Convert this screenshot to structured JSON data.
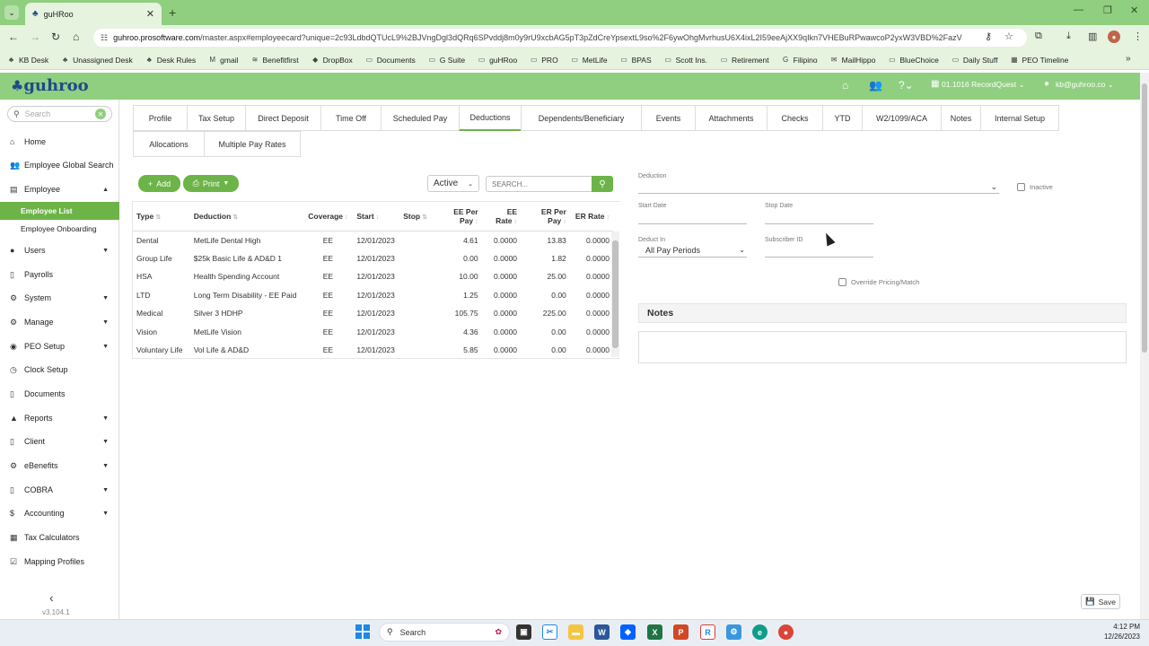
{
  "browser": {
    "tab_title": "guHRoo",
    "url_host": "guhroo.prosoftware.com",
    "url_path": "/master.aspx#employeecard?unique=2c93LdbdQTUcL9%2BJVngDgl3dQRq6SPvddj8m0y9rU9xcbAG5pT3pZdCreYpsextL9so%2F6ywOhgMvrhusU6X4ixL2I59eeAjXX9qIkn7VHEBuRPwawcoP2yxW3VBD%2FazV",
    "bookmarks": [
      {
        "label": "KB Desk",
        "icon": "kb-icon"
      },
      {
        "label": "Unassigned Desk",
        "icon": "desk-icon"
      },
      {
        "label": "Desk Rules",
        "icon": "desk-icon"
      },
      {
        "label": "gmail",
        "icon": "gmail-icon"
      },
      {
        "label": "Benefitfirst",
        "icon": "bf-icon"
      },
      {
        "label": "DropBox",
        "icon": "dropbox-icon"
      },
      {
        "label": "Documents",
        "icon": "folder-icon"
      },
      {
        "label": "G Suite",
        "icon": "folder-icon"
      },
      {
        "label": "guHRoo",
        "icon": "folder-icon"
      },
      {
        "label": "PRO",
        "icon": "folder-icon"
      },
      {
        "label": "MetLife",
        "icon": "folder-icon"
      },
      {
        "label": "BPAS",
        "icon": "folder-icon"
      },
      {
        "label": "Scott Ins.",
        "icon": "folder-icon"
      },
      {
        "label": "Retirement",
        "icon": "folder-icon"
      },
      {
        "label": "Filipino",
        "icon": "google-icon"
      },
      {
        "label": "MailHippo",
        "icon": "mailhippo-icon"
      },
      {
        "label": "BlueChoice",
        "icon": "folder-icon"
      },
      {
        "label": "Daily Stuff",
        "icon": "folder-icon"
      },
      {
        "label": "PEO Timeline",
        "icon": "sheets-icon"
      }
    ]
  },
  "header": {
    "logo": "guhroo",
    "company": "01.1016 RecordQuest",
    "user": "kb@guhroo.co"
  },
  "sidebar": {
    "search_placeholder": "Search",
    "items": [
      {
        "label": "Home",
        "icon": "home-icon",
        "top": 0
      },
      {
        "label": "Employee Global Search",
        "icon": "people-icon"
      },
      {
        "label": "Employee",
        "icon": "id-card-icon",
        "expanded": true
      },
      {
        "label": "Employee List",
        "sub": true,
        "active": true
      },
      {
        "label": "Employee Onboarding",
        "sub": true
      },
      {
        "label": "Users",
        "icon": "user-icon",
        "caret": true
      },
      {
        "label": "Payrolls",
        "icon": "doc-icon"
      },
      {
        "label": "System",
        "icon": "gear-icon",
        "caret": true
      },
      {
        "label": "Manage",
        "icon": "gears-icon",
        "caret": true
      },
      {
        "label": "PEO Setup",
        "icon": "dial-icon",
        "caret": true
      },
      {
        "label": "Clock Setup",
        "icon": "clock-icon"
      },
      {
        "label": "Documents",
        "icon": "file-icon"
      },
      {
        "label": "Reports",
        "icon": "chart-icon",
        "caret": true
      },
      {
        "label": "Client",
        "icon": "doc-icon",
        "caret": true
      },
      {
        "label": "eBenefits",
        "icon": "gear-icon",
        "caret": true
      },
      {
        "label": "COBRA",
        "icon": "doc-icon",
        "caret": true
      },
      {
        "label": "Accounting",
        "icon": "money-icon",
        "caret": true
      },
      {
        "label": "Tax Calculators",
        "icon": "calculator-icon"
      },
      {
        "label": "Mapping Profiles",
        "icon": "check-square-icon"
      }
    ],
    "version": "v3.104.1"
  },
  "tabs_row1": [
    "Profile",
    "Tax Setup",
    "Direct Deposit",
    "Time Off",
    "Scheduled Pay",
    "Deductions",
    "Dependents/Beneficiary",
    "Events",
    "Attachments",
    "Checks",
    "YTD",
    "W2/1099/ACA",
    "Notes",
    "Internal Setup"
  ],
  "tabs_row2": [
    "Allocations",
    "Multiple Pay Rates"
  ],
  "active_tab": "Deductions",
  "toolbar": {
    "add_label": "Add",
    "print_label": "Print",
    "status_value": "Active",
    "search_placeholder": "SEARCH..."
  },
  "table": {
    "headers": [
      "Type",
      "Deduction",
      "Coverage",
      "Start",
      "Stop",
      "EE Per Pay",
      "EE Rate",
      "ER Per Pay",
      "ER Rate"
    ],
    "rows": [
      [
        "Dental",
        "MetLife Dental High",
        "EE",
        "12/01/2023",
        "",
        "4.61",
        "0.0000",
        "13.83",
        "0.0000"
      ],
      [
        "Group Life",
        "$25k Basic Life & AD&D 1",
        "EE",
        "12/01/2023",
        "",
        "0.00",
        "0.0000",
        "1.82",
        "0.0000"
      ],
      [
        "HSA",
        "Health Spending Account",
        "EE",
        "12/01/2023",
        "",
        "10.00",
        "0.0000",
        "25.00",
        "0.0000"
      ],
      [
        "LTD",
        "Long Term Disability - EE Paid",
        "EE",
        "12/01/2023",
        "",
        "1.25",
        "0.0000",
        "0.00",
        "0.0000"
      ],
      [
        "Medical",
        "Silver 3 HDHP",
        "EE",
        "12/01/2023",
        "",
        "105.75",
        "0.0000",
        "225.00",
        "0.0000"
      ],
      [
        "Vision",
        "MetLife Vision",
        "EE",
        "12/01/2023",
        "",
        "4.36",
        "0.0000",
        "0.00",
        "0.0000"
      ],
      [
        "Voluntary Life",
        "Vol Life & AD&D",
        "EE",
        "12/01/2023",
        "",
        "5.85",
        "0.0000",
        "0.00",
        "0.0000"
      ]
    ]
  },
  "form": {
    "deduction_label": "Deduction",
    "inactive_label": "Inactive",
    "start_date_label": "Start Date",
    "stop_date_label": "Stop Date",
    "deduct_in_label": "Deduct In",
    "deduct_in_value": "All Pay Periods",
    "subscriber_id_label": "Subscriber ID",
    "override_label": "Override Pricing/Match",
    "notes_title": "Notes",
    "save_label": "Save"
  },
  "taskbar": {
    "search_label": "Search",
    "time": "4:12 PM",
    "date": "12/26/2023"
  },
  "colors": {
    "brand_green": "#8fcf7f",
    "button_green": "#6cb447",
    "logo_blue": "#1f4a8a"
  }
}
